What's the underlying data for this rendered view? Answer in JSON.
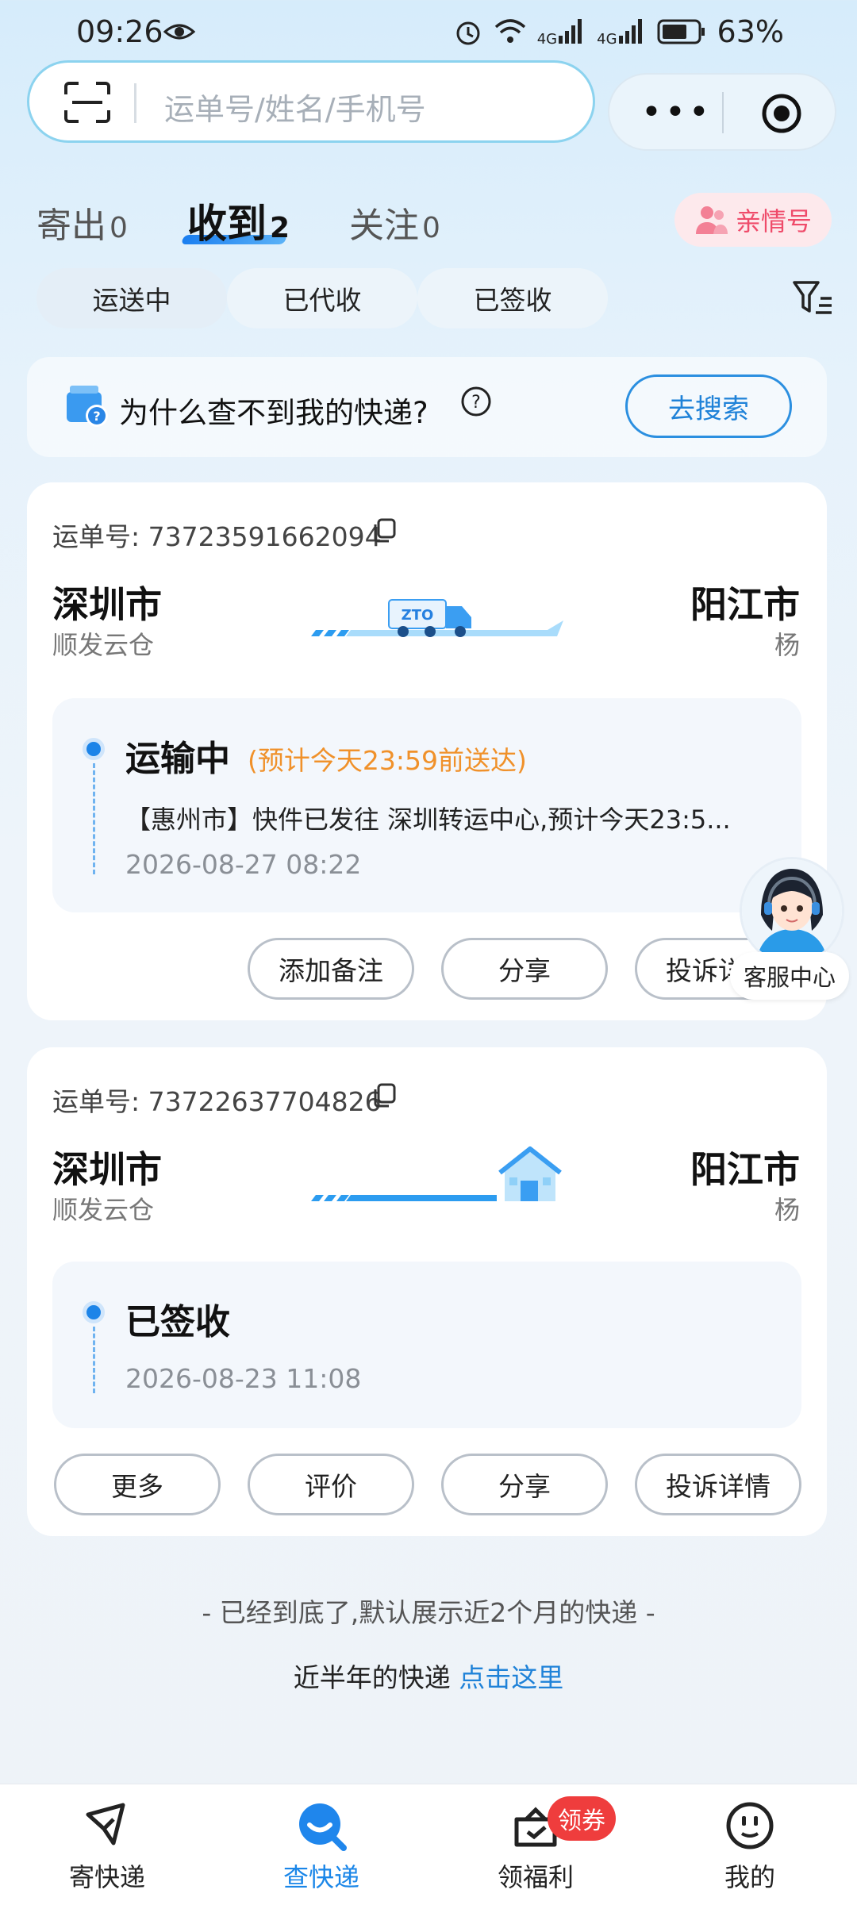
{
  "status_bar": {
    "time": "09:26",
    "signal1": "4G",
    "signal2": "4G",
    "battery": "63%"
  },
  "search": {
    "placeholder": "运单号/姓名/手机号"
  },
  "tabs": [
    {
      "label": "寄出",
      "count": "0"
    },
    {
      "label": "收到",
      "count": "2"
    },
    {
      "label": "关注",
      "count": "0"
    }
  ],
  "family_button": "亲情号",
  "filters": [
    "运送中",
    "已代收",
    "已签收"
  ],
  "why_banner": {
    "text": "为什么查不到我的快递?",
    "button": "去搜索"
  },
  "cards": [
    {
      "waybill_label": "运单号:",
      "waybill": "73723591662094",
      "from_city": "深圳市",
      "from_sub": "顺发云仓",
      "to_city": "阳江市",
      "to_sub": "杨",
      "status": "运输中",
      "eta": "(预计今天23:59前送达)",
      "message": "【惠州市】快件已发往 深圳转运中心,预计今天23:5...",
      "time": "2026-08-27 08:22",
      "actions": [
        "添加备注",
        "分享",
        "投诉详情"
      ]
    },
    {
      "waybill_label": "运单号:",
      "waybill": "73722637704826",
      "from_city": "深圳市",
      "from_sub": "顺发云仓",
      "to_city": "阳江市",
      "to_sub": "杨",
      "status": "已签收",
      "time": "2026-08-23 11:08",
      "actions": [
        "更多",
        "评价",
        "分享",
        "投诉详情"
      ]
    }
  ],
  "service": {
    "label": "客服中心"
  },
  "footer": {
    "end_text": "- 已经到底了,默认展示近2个月的快递 -",
    "half_year_text": "近半年的快递",
    "half_year_link": "点击这里"
  },
  "nav": [
    {
      "label": "寄快递",
      "icon": "send-icon"
    },
    {
      "label": "查快递",
      "icon": "search-package-icon"
    },
    {
      "label": "领福利",
      "icon": "gift-icon"
    },
    {
      "label": "我的",
      "icon": "profile-icon"
    }
  ],
  "nav_badge": "领券",
  "colors": {
    "primary": "#1a86e8",
    "eta": "#f0912a",
    "badge": "#ef3d3d",
    "family": "#ef4b6a"
  }
}
